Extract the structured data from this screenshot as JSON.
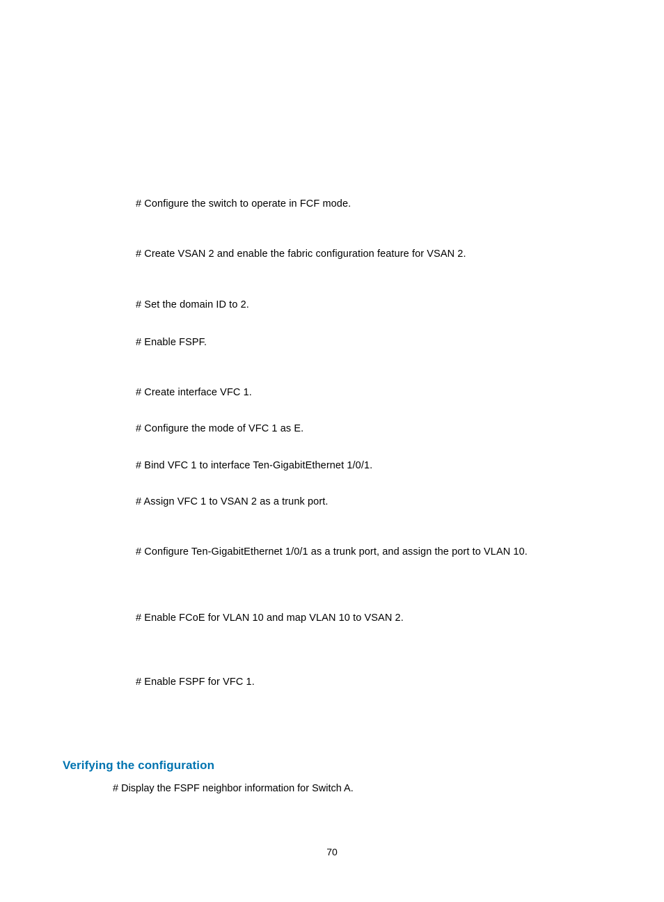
{
  "steps": {
    "s1": "# Configure the switch to operate in FCF mode.",
    "s2": "# Create VSAN 2 and enable the fabric configuration feature for VSAN 2.",
    "s3": "# Set the domain ID to 2.",
    "s4": "# Enable FSPF.",
    "s5": "# Create interface VFC 1.",
    "s6": "# Configure the mode of VFC 1 as E.",
    "s7": "# Bind VFC 1 to interface Ten-GigabitEthernet 1/0/1.",
    "s8": "# Assign VFC 1 to VSAN 2 as a trunk port.",
    "s9": "# Configure Ten-GigabitEthernet 1/0/1 as a trunk port, and assign the port to VLAN 10.",
    "s10": "# Enable FCoE for VLAN 10 and map VLAN 10 to VSAN 2.",
    "s11": "# Enable FSPF for VFC 1."
  },
  "heading": "Verifying the configuration",
  "substep": "# Display the FSPF neighbor information for Switch A.",
  "pageNumber": "70"
}
